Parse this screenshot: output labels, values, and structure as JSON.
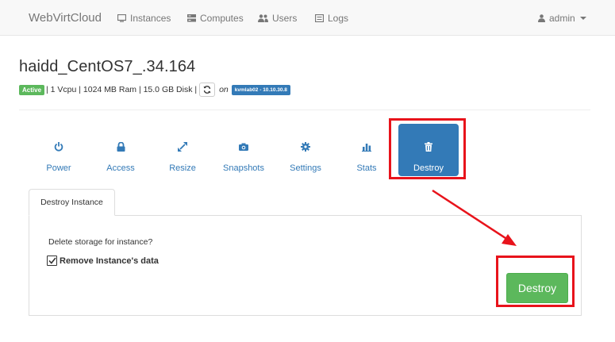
{
  "navbar": {
    "brand": "WebVirtCloud",
    "items": [
      {
        "label": "Instances",
        "icon": "monitor-icon"
      },
      {
        "label": "Computes",
        "icon": "server-icon"
      },
      {
        "label": "Users",
        "icon": "users-icon"
      },
      {
        "label": "Logs",
        "icon": "list-icon"
      }
    ],
    "user": {
      "label": "admin",
      "icon": "user-icon"
    }
  },
  "instance": {
    "name": "haidd_CentOS7_.34.164",
    "status": "Active",
    "specs": "| 1 Vcpu | 1024 MB Ram | 15.0 GB Disk |",
    "on_label": "on",
    "host": "kvmlab02 - 10.10.30.8"
  },
  "actions": [
    {
      "label": "Power",
      "icon": "power-icon"
    },
    {
      "label": "Access",
      "icon": "lock-icon"
    },
    {
      "label": "Resize",
      "icon": "resize-icon"
    },
    {
      "label": "Snapshots",
      "icon": "camera-icon"
    },
    {
      "label": "Settings",
      "icon": "gear-icon"
    },
    {
      "label": "Stats",
      "icon": "bar-chart-icon"
    },
    {
      "label": "Destroy",
      "icon": "trash-icon",
      "active": true
    }
  ],
  "destroy_panel": {
    "tab_label": "Destroy Instance",
    "question": "Delete storage for instance?",
    "checkbox_label": "Remove Instance's data",
    "checkbox_checked": true,
    "submit_label": "Destroy"
  },
  "colors": {
    "primary": "#337ab7",
    "success": "#5cb85c",
    "annotation": "#e8131b"
  }
}
